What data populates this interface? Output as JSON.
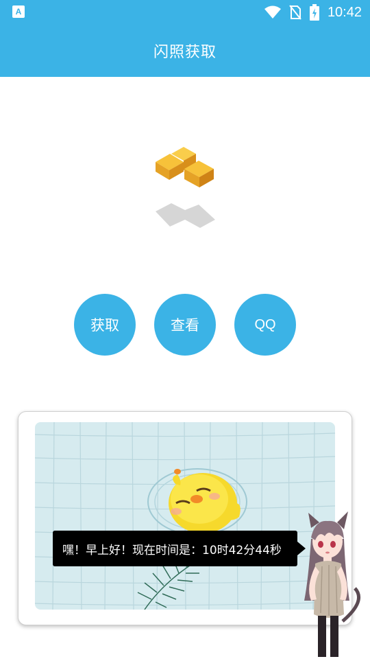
{
  "status_bar": {
    "time": "10:42",
    "icons": [
      "a-notification-icon",
      "wifi-icon",
      "no-sim-icon",
      "battery-charging-icon"
    ]
  },
  "app_bar": {
    "title": "闪照获取"
  },
  "buttons": {
    "get_label": "获取",
    "view_label": "查看",
    "qq_label": "QQ"
  },
  "assistant": {
    "message": "嘿！早上好！现在时间是：10时42分44秒"
  },
  "colors": {
    "primary": "#3bb3e6",
    "bubble_bg": "#000000",
    "cube_top": "#f7c23a",
    "cube_side": "#e09a22"
  }
}
